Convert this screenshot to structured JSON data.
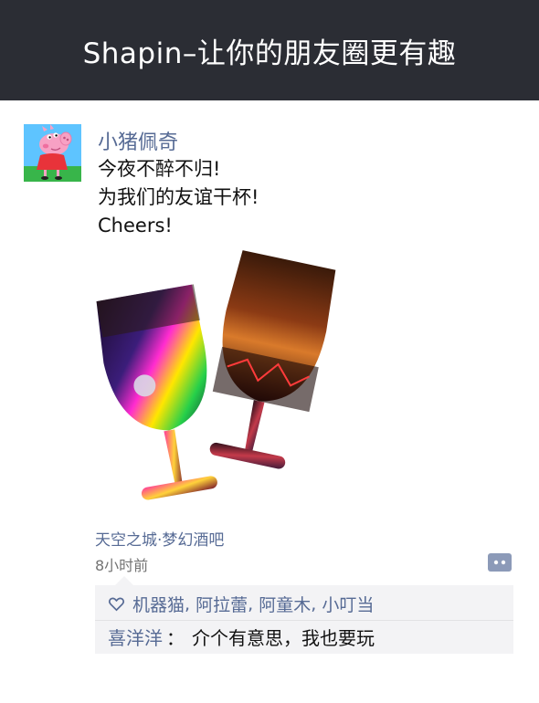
{
  "header": {
    "title": "Shapin–让你的朋友圈更有趣"
  },
  "post": {
    "author": "小猪佩奇",
    "text_lines": [
      "今夜不醉不归!",
      "为我们的友谊干杯!",
      "Cheers!"
    ],
    "location": "天空之城·梦幻酒吧",
    "time": "8小时前"
  },
  "interactions": {
    "likers": [
      "机器猫",
      "阿拉蕾",
      "阿童木",
      "小叮当"
    ],
    "separator": ",",
    "comments": [
      {
        "author": "喜洋洋",
        "colon": "：",
        "text": "介个有意思，我也要玩"
      }
    ]
  },
  "icons": {
    "avatar": "peppa-pig-avatar",
    "comment": "comment-bubble-icon",
    "like": "heart-icon"
  },
  "colors": {
    "header_bg": "#2b2d34",
    "link": "#576b95",
    "comment_bg": "#f3f3f5"
  }
}
